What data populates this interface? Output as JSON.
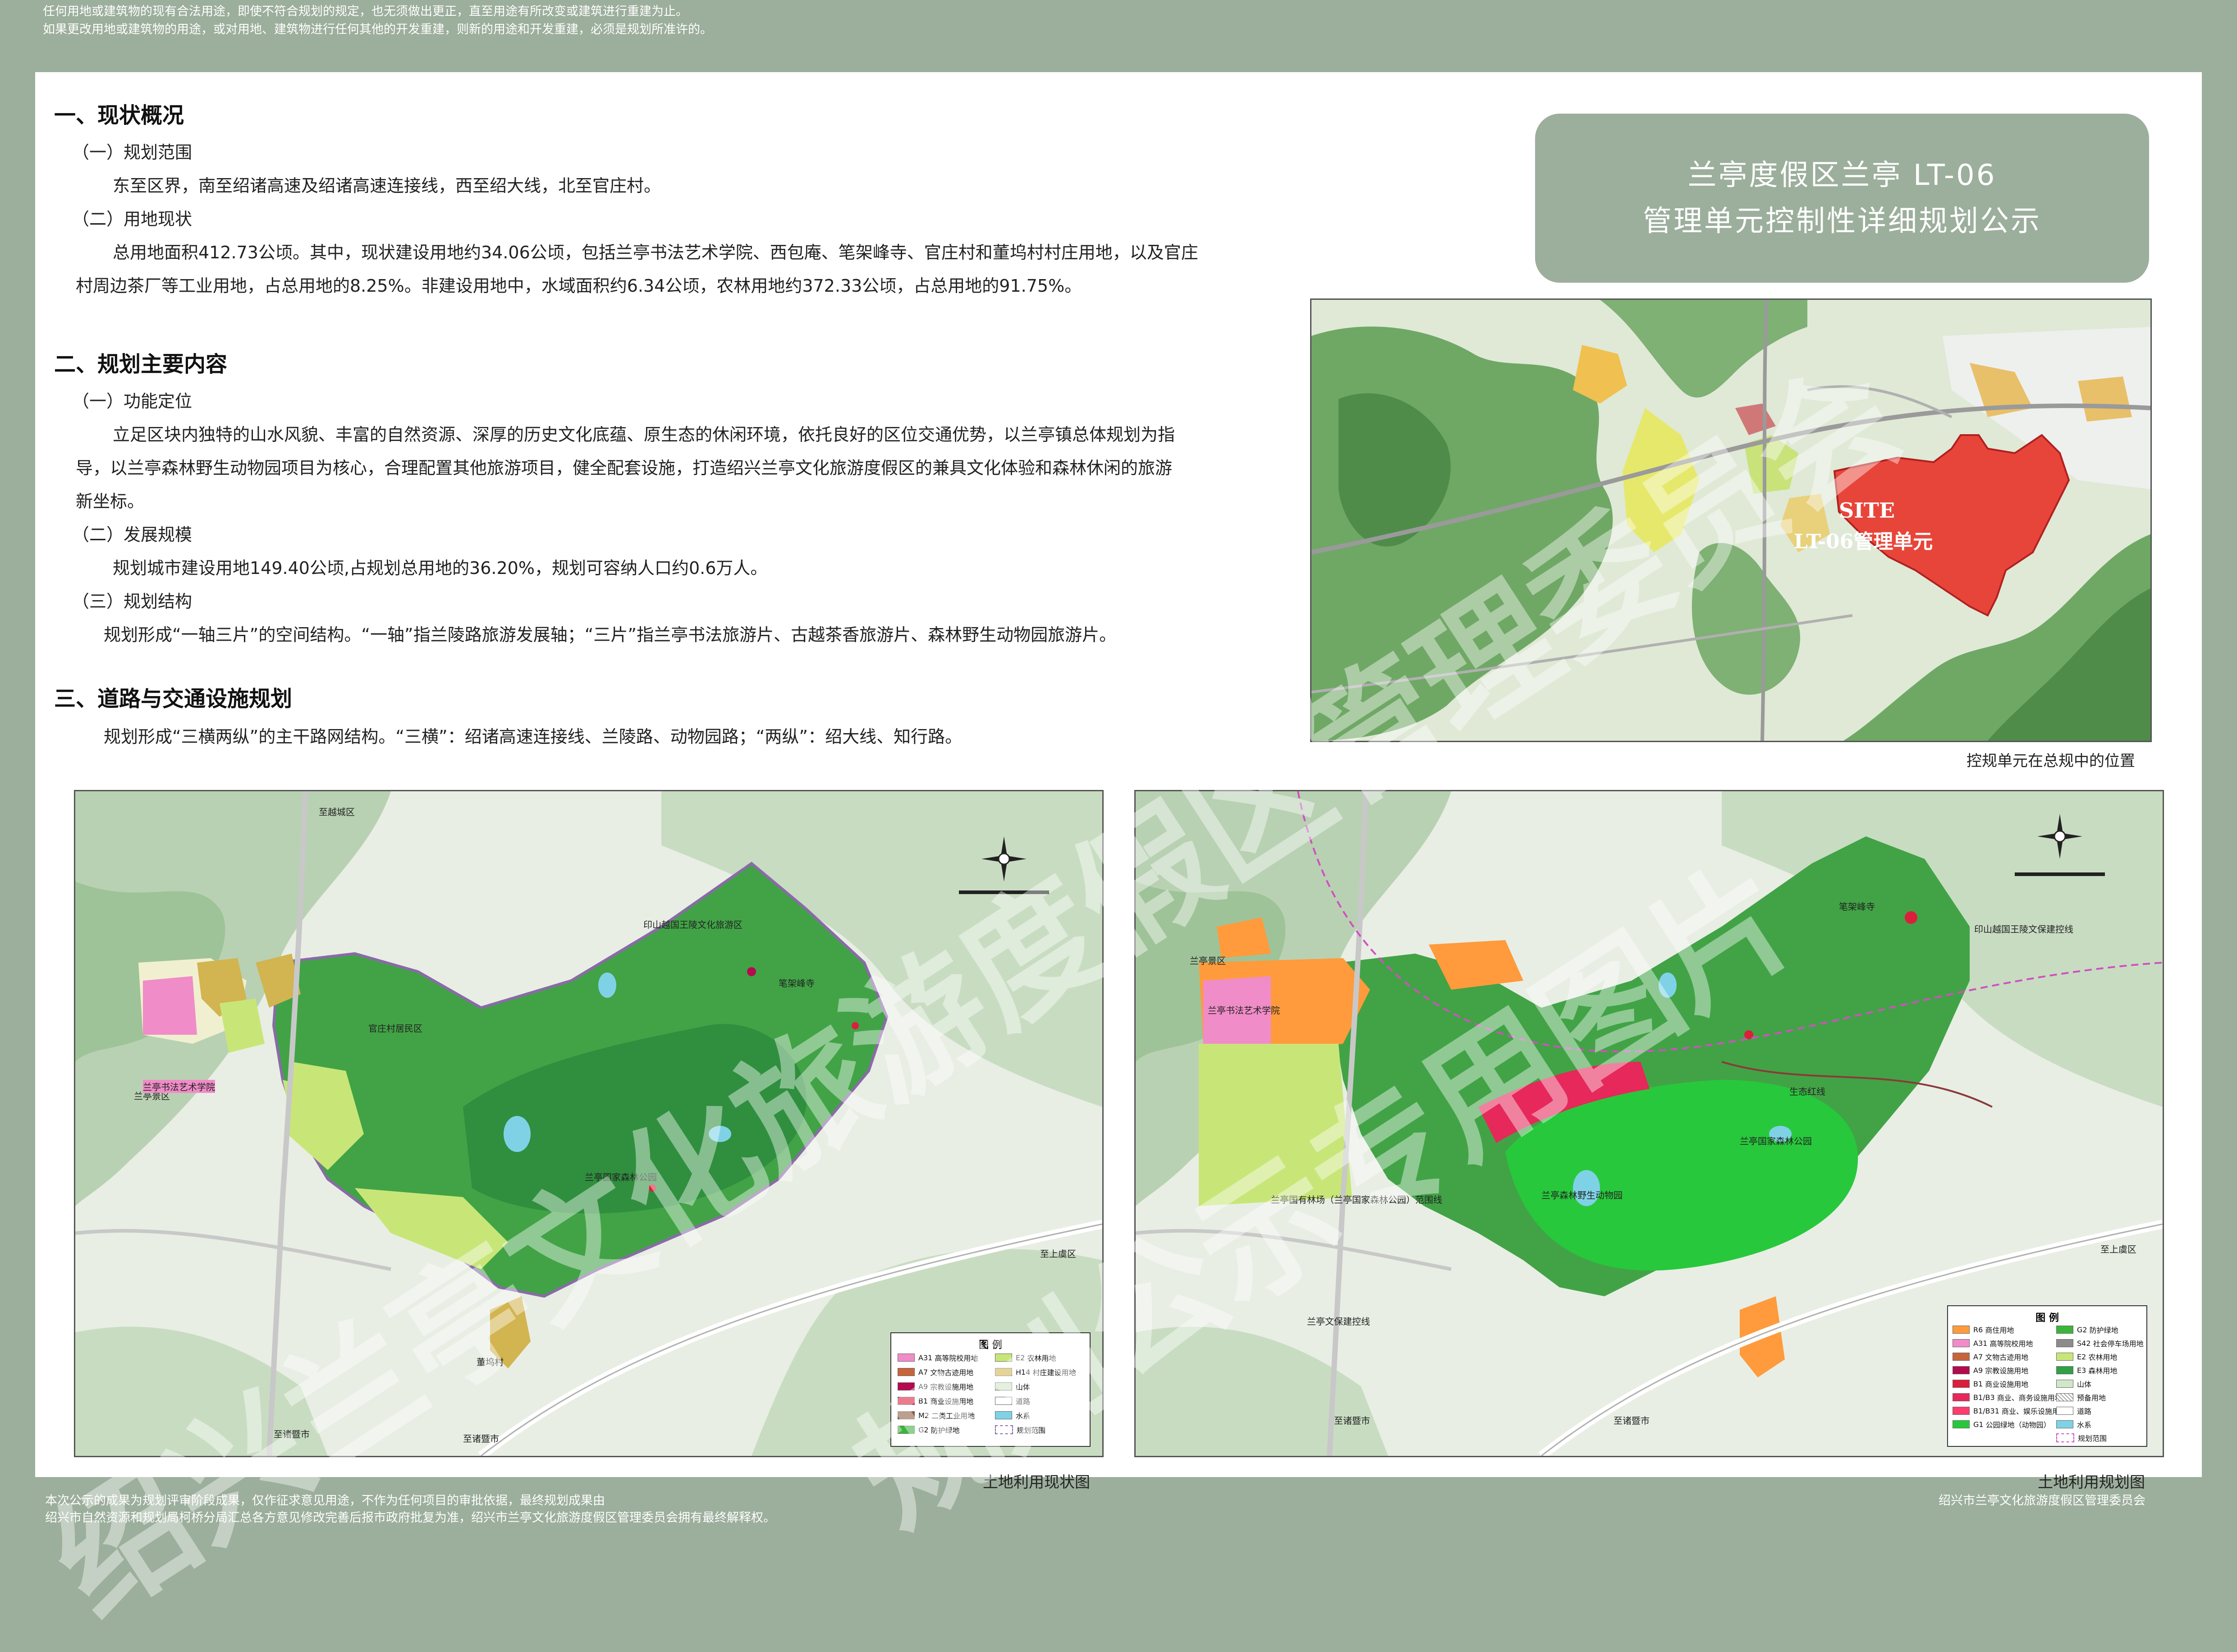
{
  "notice_top": [
    "任何用地或建筑物的现有合法用途，即使不符合规划的规定，也无须做出更正，直至用途有所改变或建筑进行重建为止。",
    "如果更改用地或建筑物的用途，或对用地、建筑物进行任何其他的开发重建，则新的用途和开发重建，必须是规划所准许的。"
  ],
  "title": {
    "line1": "兰亭度假区兰亭 LT-06",
    "line2": "管理单元控制性详细规划公示"
  },
  "sections": {
    "s1": {
      "heading": "一、现状概况",
      "sub1": "（一）规划范围",
      "p1": "东至区界，南至绍诸高速及绍诸高速连接线，西至绍大线，北至官庄村。",
      "sub2": "（二）用地现状",
      "p2a": "总用地面积412.73公顷。其中，现状建设用地约34.06公顷，包括兰亭书法艺术学院、西包庵、笔架峰寺、官庄村和董坞村村庄用地，以及官庄",
      "p2b": "村周边茶厂等工业用地，占总用地的8.25%。非建设用地中，水域面积约6.34公顷，农林用地约372.33公顷，占总用地的91.75%。"
    },
    "s2": {
      "heading": "二、规划主要内容",
      "sub1": "（一）功能定位",
      "p1a": "立足区块内独特的山水风貌、丰富的自然资源、深厚的历史文化底蕴、原生态的休闲环境，依托良好的区位交通优势，以兰亭镇总体规划为指",
      "p1b": "导，以兰亭森林野生动物园项目为核心，合理配置其他旅游项目，健全配套设施，打造绍兴兰亭文化旅游度假区的兼具文化体验和森林休闲的旅游",
      "p1c": "新坐标。",
      "sub2": "（二）发展规模",
      "p2": "规划城市建设用地149.40公顷,占规划总用地的36.20%，规划可容纳人口约0.6万人。",
      "sub3": "（三）规划结构",
      "p3": "规划形成“一轴三片”的空间结构。“一轴”指兰陵路旅游发展轴；“三片”指兰亭书法旅游片、古越茶香旅游片、森林野生动物园旅游片。"
    },
    "s3": {
      "heading": "三、道路与交通设施规划",
      "p1": "规划形成“三横两纵”的主干路网结构。“三横”：绍诸高速连接线、兰陵路、动物园路；“两纵”：绍大线、知行路。"
    }
  },
  "maps": {
    "location": {
      "caption": "控规单元在总规中的位置",
      "site_line1": "SITE",
      "site_line2": "LT-06管理单元"
    },
    "current": {
      "caption": "土地利用现状图",
      "labels": {
        "to_yuecheng": "至越城区",
        "to_shangyu": "至上虞区",
        "to_zhuji1": "至诸暨市",
        "to_zhuji2": "至诸暨市",
        "lanting_area": "兰亭景区",
        "academy": "兰亭书法艺术学院",
        "forest_park": "兰亭国家森林公园",
        "guanzhuang": "官庄村居民区",
        "dongwu": "董坞村",
        "bijiafeng": "笔架峰寺",
        "yinshan": "印山越国王陵文化旅游区"
      },
      "legend": {
        "title": "图 例",
        "items": [
          {
            "code": "A31",
            "name": "高等院校用地",
            "color": "#f08cc8"
          },
          {
            "code": "A7",
            "name": "文物古迹用地",
            "color": "#c8643c"
          },
          {
            "code": "A9",
            "name": "宗教设施用地",
            "color": "#b40a50"
          },
          {
            "code": "B1",
            "name": "商业设施用地",
            "color": "#dc1e3c"
          },
          {
            "code": "M2",
            "name": "二类工业用地",
            "color": "#8c5a3c"
          },
          {
            "code": "G2",
            "name": "防护绿地",
            "color": "#3cb43c"
          },
          {
            "code": "E2",
            "name": "农林用地",
            "color": "#c8e678"
          },
          {
            "code": "H14",
            "name": "村庄建设用地",
            "color": "#d2b450"
          },
          {
            "code": "",
            "name": "山体",
            "color": "#d2e6c8"
          },
          {
            "code": "",
            "name": "道路",
            "color": "#ffffff"
          },
          {
            "code": "",
            "name": "水系",
            "color": "#7fd2e6"
          },
          {
            "code": "",
            "name": "规划范围",
            "color": "#ffffff"
          }
        ]
      }
    },
    "plan": {
      "caption": "土地利用规划图",
      "labels": {
        "lanting_area": "兰亭景区",
        "academy": "兰亭书法艺术学院",
        "forest_farm": "兰亭国有林场（兰亭国家森林公园）范围线",
        "eco_line": "生态红线",
        "protect_line": "兰亭文保建控线",
        "yinshan_line": "印山越国王陵文保建控线",
        "zoo": "兰亭森林野生动物园",
        "forest_park": "兰亭国家森林公园",
        "to_shangyu": "至上虞区",
        "to_zhuji1": "至诸暨市",
        "to_zhuji2": "至诸暨市",
        "bijiafeng": "笔架峰寺"
      },
      "legend": {
        "title": "图 例",
        "items": [
          {
            "code": "R6",
            "name": "商住用地",
            "color": "#ff9b3c"
          },
          {
            "code": "A31",
            "name": "高等院校用地",
            "color": "#f08cc8"
          },
          {
            "code": "A7",
            "name": "文物古迹用地",
            "color": "#c8643c"
          },
          {
            "code": "A9",
            "name": "宗教设施用地",
            "color": "#b40a50"
          },
          {
            "code": "B1",
            "name": "商业设施用地",
            "color": "#dc1e3c"
          },
          {
            "code": "B1/B3",
            "name": "商业、商务设施用地",
            "color": "#e6285a"
          },
          {
            "code": "B1/B31",
            "name": "商业、娱乐设施用地",
            "color": "#ff3c6e"
          },
          {
            "code": "G1",
            "name": "公园绿地（动物园）",
            "color": "#28c83c"
          },
          {
            "code": "G2",
            "name": "防护绿地",
            "color": "#3cb43c"
          },
          {
            "code": "S42",
            "name": "社会停车场用地",
            "color": "#8c8c8c"
          },
          {
            "code": "E2",
            "name": "农林用地",
            "color": "#c8e678"
          },
          {
            "code": "E3",
            "name": "森林用地",
            "color": "#32a046"
          },
          {
            "code": "",
            "name": "山体",
            "color": "#d2e6c8"
          },
          {
            "code": "",
            "name": "预备用地",
            "color": "#ffffff"
          },
          {
            "code": "",
            "name": "道路",
            "color": "#ffffff"
          },
          {
            "code": "",
            "name": "水系",
            "color": "#7fd2e6"
          },
          {
            "code": "",
            "name": "规划范围",
            "color": "#ffffff"
          }
        ]
      }
    }
  },
  "footer": {
    "left1": "本次公示的成果为规划评审阶段成果，仅作征求意见用途，不作为任何项目的审批依据，最终规划成果由",
    "left2": "绍兴市自然资源和规划局柯桥分局汇总各方意见修改完善后报市政府批复为准，绍兴市兰亭文化旅游度假区管理委员会拥有最终解释权。",
    "right": "绍兴市兰亭文化旅游度假区管理委员会"
  },
  "watermark": {
    "line1": "绍兴兰亭文化旅游度假区管理委员会",
    "line2": "规划公示专用图片"
  }
}
